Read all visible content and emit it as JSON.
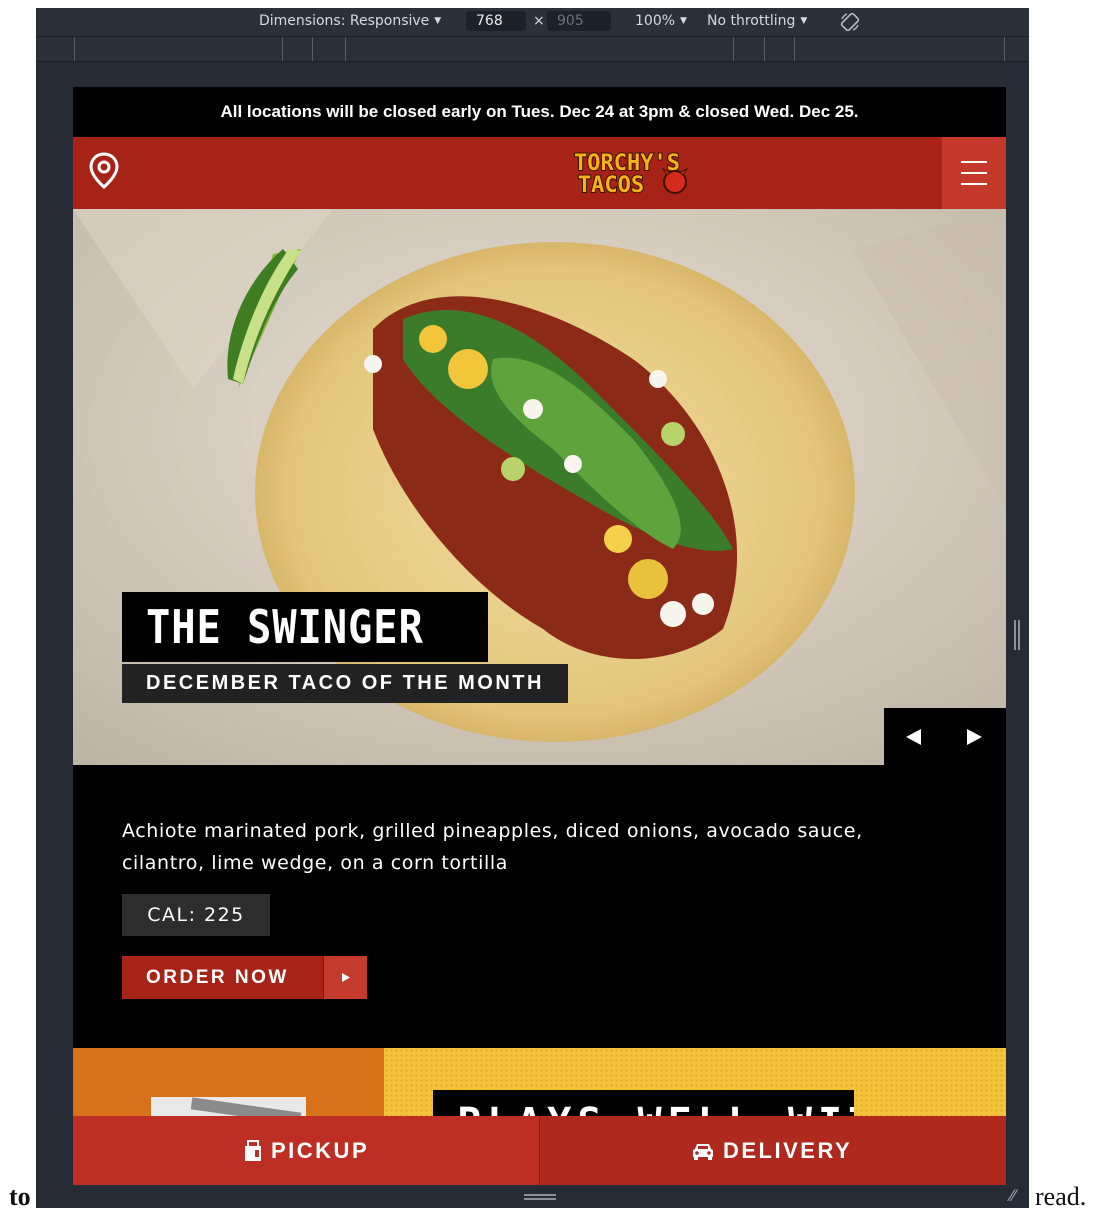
{
  "devtools": {
    "dimensions_label": "Dimensions: Responsive",
    "width_value": "768",
    "times_sign": "×",
    "height_value": "905",
    "zoom_label": "100%",
    "throttling_label": "No throttling"
  },
  "site": {
    "announcement": "All locations will be closed early on Tues. Dec 24 at 3pm & closed Wed. Dec 25.",
    "logo_text": [
      "TORCHY'S",
      "TACOS"
    ],
    "colors": {
      "brand_red": "#a82317",
      "promo_orange": "#d7721a",
      "promo_yellow": "#f3c33a"
    },
    "hero": {
      "title": "THE SWINGER",
      "subtitle": "DECEMBER TACO OF THE MONTH",
      "prev_icon": "triangle-left-icon",
      "next_icon": "triangle-right-icon"
    },
    "description": "Achiote marinated pork, grilled pineapples, diced onions, avocado sauce, cilantro, lime wedge, on a corn tortilla",
    "calories": "CAL: 225",
    "order_button": "ORDER NOW",
    "promo_heading": "PLAYS WELL WITH:",
    "bottom_bar": {
      "pickup": "PICKUP",
      "delivery": "DELIVERY"
    }
  },
  "page_text": {
    "left_fragment": "to",
    "right_fragment": "read."
  }
}
